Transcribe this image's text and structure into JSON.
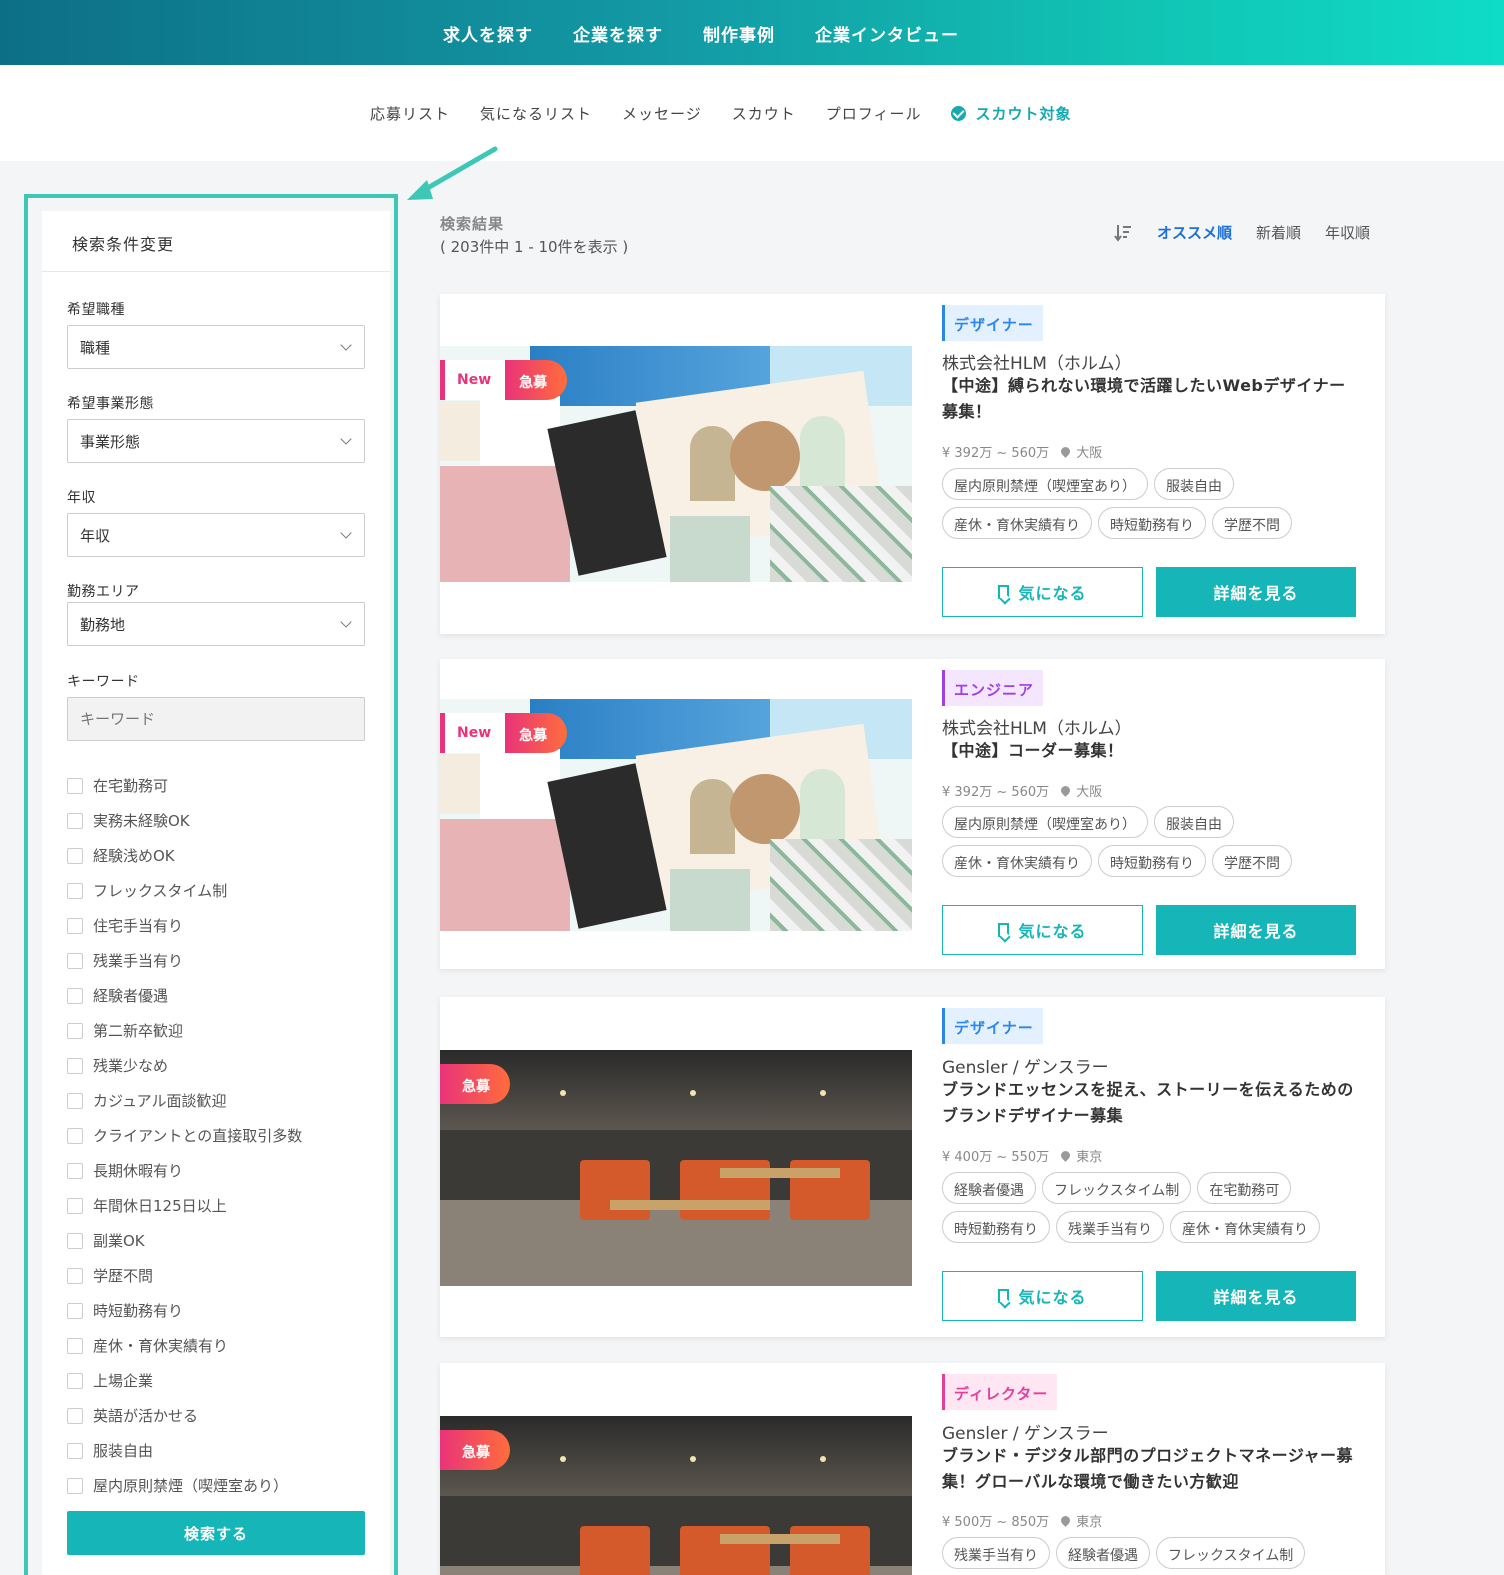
{
  "topnav": {
    "links": [
      "求人を探す",
      "企業を探す",
      "制作事例",
      "企業インタビュー"
    ]
  },
  "subnav": {
    "links": [
      "応募リスト",
      "気になるリスト",
      "メッセージ",
      "スカウト",
      "プロフィール"
    ],
    "active": "スカウト対象"
  },
  "sidebar": {
    "title": "検索条件変更",
    "fields": [
      {
        "label": "希望職種",
        "value": "職種"
      },
      {
        "label": "希望事業形態",
        "value": "事業形態"
      },
      {
        "label": "年収",
        "value": "年収"
      },
      {
        "label": "勤務エリア",
        "value": "勤務地"
      }
    ],
    "keyword": {
      "label": "キーワード",
      "placeholder": "キーワード"
    },
    "checkboxes": [
      "在宅勤務可",
      "実務未経験OK",
      "経験浅めOK",
      "フレックスタイム制",
      "住宅手当有り",
      "残業手当有り",
      "経験者優遇",
      "第二新卒歓迎",
      "残業少なめ",
      "カジュアル面談歓迎",
      "クライアントとの直接取引多数",
      "長期休暇有り",
      "年間休日125日以上",
      "副業OK",
      "学歴不問",
      "時短勤務有り",
      "産休・育休実績有り",
      "上場企業",
      "英語が活かせる",
      "服装自由",
      "屋内原則禁煙（喫煙室あり）"
    ],
    "search_button": "検索する"
  },
  "results": {
    "title": "検索結果",
    "count": "( 203件中 1 - 10件を表示 )"
  },
  "sort": {
    "options": [
      "オススメ順",
      "新着順",
      "年収順"
    ],
    "active": "オススメ順"
  },
  "buttons": {
    "fav": "気になる",
    "detail": "詳細を見る"
  },
  "badges": {
    "new": "New",
    "urgent": "急募"
  },
  "jobs": [
    {
      "category": "デザイナー",
      "company": "株式会社HLM（ホルム）",
      "title": "【中途】縛られない環境で活躍したいWebデザイナー募集！",
      "salary": "¥ 392万 ~ 560万",
      "location": "大阪",
      "tags": [
        "屋内原則禁煙（喫煙室あり）",
        "服装自由",
        "産休・育休実績有り",
        "時短勤務有り",
        "学歴不問"
      ]
    },
    {
      "category": "エンジニア",
      "company": "株式会社HLM（ホルム）",
      "title": "【中途】コーダー募集！",
      "salary": "¥ 392万 ~ 560万",
      "location": "大阪",
      "tags": [
        "屋内原則禁煙（喫煙室あり）",
        "服装自由",
        "産休・育休実績有り",
        "時短勤務有り",
        "学歴不問"
      ]
    },
    {
      "category": "デザイナー",
      "company": "Gensler / ゲンスラー",
      "title": "ブランドエッセンスを捉え、ストーリーを伝えるためのブランドデザイナー募集",
      "salary": "¥ 400万 ~ 550万",
      "location": "東京",
      "tags": [
        "経験者優遇",
        "フレックスタイム制",
        "在宅勤務可",
        "時短勤務有り",
        "残業手当有り",
        "産休・育休実績有り"
      ]
    },
    {
      "category": "ディレクター",
      "company": "Gensler / ゲンスラー",
      "title": "ブランド・デジタル部門のプロジェクトマネージャー募集！グローバルな環境で働きたい方歓迎",
      "salary": "¥ 500万 ~ 850万",
      "location": "東京",
      "tags": [
        "残業手当有り",
        "経験者優遇",
        "フレックスタイム制"
      ]
    }
  ]
}
